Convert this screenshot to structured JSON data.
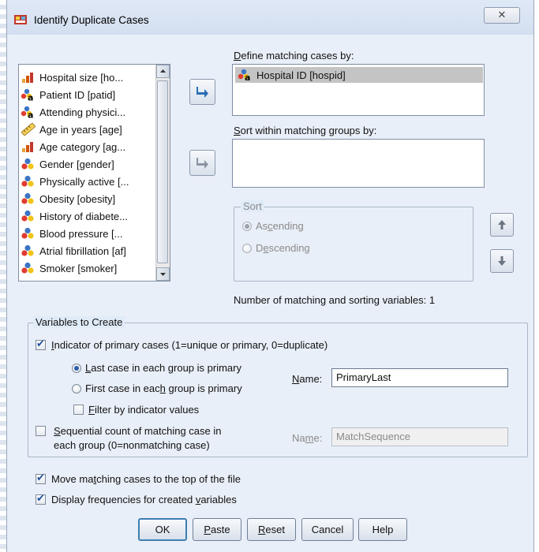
{
  "window": {
    "title": "Identify Duplicate Cases",
    "close_glyph": "✕"
  },
  "variables": [
    {
      "label": "Hospital size [ho...",
      "icon": "ordinal-bar-icon"
    },
    {
      "label": "Patient ID [patid]",
      "icon": "nominal-string-icon"
    },
    {
      "label": "Attending physici...",
      "icon": "nominal-string-icon"
    },
    {
      "label": "Age in years [age]",
      "icon": "scale-ruler-icon"
    },
    {
      "label": "Age category [ag...",
      "icon": "ordinal-bar-icon"
    },
    {
      "label": "Gender [gender]",
      "icon": "nominal-icon"
    },
    {
      "label": "Physically active [...",
      "icon": "nominal-icon"
    },
    {
      "label": "Obesity [obesity]",
      "icon": "nominal-icon"
    },
    {
      "label": "History of diabete...",
      "icon": "nominal-icon"
    },
    {
      "label": "Blood pressure [...",
      "icon": "nominal-icon"
    },
    {
      "label": "Atrial fibrillation [af]",
      "icon": "nominal-icon"
    },
    {
      "label": "Smoker [smoker]",
      "icon": "nominal-icon"
    }
  ],
  "define": {
    "label_pre": "",
    "label_key": "D",
    "label_post": "efine matching cases by:",
    "items": [
      "Hospital ID [hospid]"
    ]
  },
  "sortwithin": {
    "label_pre": "",
    "label_key": "S",
    "label_post": "ort within matching groups by:"
  },
  "sort": {
    "title": "Sort",
    "asc": {
      "pre": "As",
      "key": "c",
      "post": "ending"
    },
    "desc": {
      "pre": "D",
      "key": "e",
      "post": "scending"
    }
  },
  "count_text": "Number of matching and sorting variables:  1",
  "create": {
    "title": "Variables to Create",
    "indicator": {
      "pre": "",
      "key": "I",
      "post": "ndicator of primary cases (1=unique or primary, 0=duplicate)"
    },
    "last": {
      "pre": "",
      "key": "L",
      "post": "ast case in each group is primary"
    },
    "first": {
      "pre": "First case in eac",
      "key": "h",
      "post": " group is primary"
    },
    "filter": {
      "pre": "",
      "key": "F",
      "post": "ilter by indicator values"
    },
    "name1": {
      "pre": "",
      "key": "N",
      "post": "ame:",
      "value": "PrimaryLast"
    },
    "sequential": {
      "pre": "",
      "key": "S",
      "post": "equential count of matching case in",
      "line2": "each group (0=nonmatching case)"
    },
    "name2": {
      "pre": "Na",
      "key": "m",
      "post": "e:",
      "value": "MatchSequence"
    }
  },
  "move": {
    "pre": "Move ma",
    "key": "t",
    "post": "ching cases to the top of the file"
  },
  "display": {
    "pre": "Display frequencies for created ",
    "key": "v",
    "post": "ariables"
  },
  "buttons": {
    "ok": "OK",
    "paste": {
      "key": "P",
      "post": "aste"
    },
    "reset": {
      "key": "R",
      "post": "eset"
    },
    "cancel": "Cancel",
    "help": "Help"
  },
  "colors": {
    "accent": "#2a5da8",
    "bg": "#e0ebf8"
  }
}
